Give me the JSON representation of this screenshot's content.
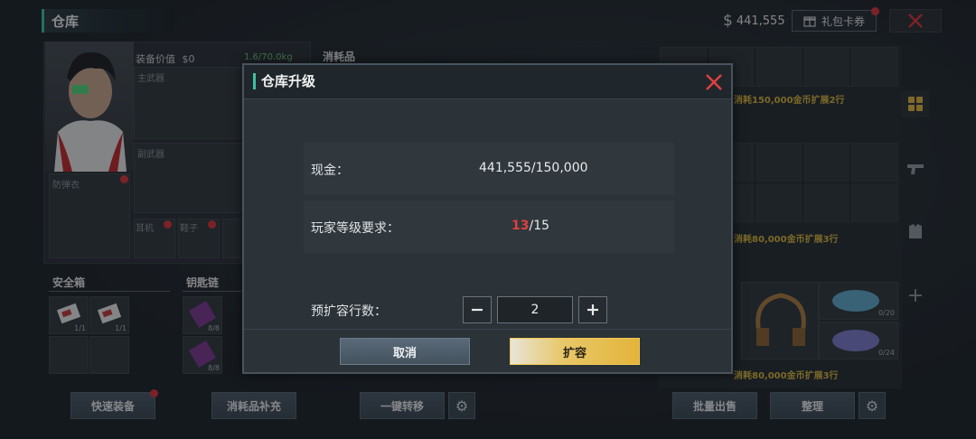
{
  "header": {
    "title": "仓库",
    "money": "441,555",
    "giftcard_label": "礼包卡券"
  },
  "left": {
    "equip_value_label": "装备价值",
    "equip_value": "$0",
    "weight": "1.6/70.0kg",
    "primary_label": "主武器",
    "secondary_label": "副武器",
    "armor_label": "防弹衣",
    "headset_label": "耳机",
    "shoes_label": "鞋子",
    "consumables_label": "消耗品",
    "safe_box_label": "安全箱",
    "safe_counts": [
      "1/1",
      "1/1"
    ],
    "keychain_label": "钥匙链",
    "key_counts": [
      "8/8",
      "8/8"
    ]
  },
  "bottom": {
    "quick_equip": "快速装备",
    "refill": "消耗品补充",
    "transfer": "一键转移",
    "bulk_sell": "批量出售",
    "organize": "整理"
  },
  "right": {
    "expand_1": "消耗150,000金币扩展2行",
    "expand_2": "消耗80,000金币扩展3行",
    "expand_3": "消耗80,000金币扩展3行",
    "item_count_1": "0/20",
    "item_count_2": "0/24"
  },
  "modal": {
    "title": "仓库升级",
    "cash_label": "现金：",
    "cash_value": "441,555/150,000",
    "level_label": "玩家等级要求：",
    "level_current": "13",
    "level_required": "/15",
    "rows_label": "预扩容行数：",
    "rows_value": "2",
    "cancel": "取消",
    "confirm": "扩容"
  },
  "colors": {
    "accent_teal": "#3fc0a0",
    "gold": "#e3b43a",
    "warning_red": "#e0403f",
    "close_red": "#d8343a"
  }
}
